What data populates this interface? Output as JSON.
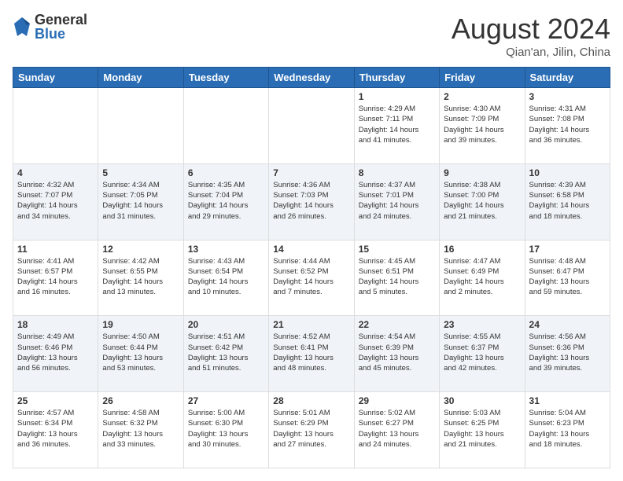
{
  "header": {
    "logo_general": "General",
    "logo_blue": "Blue",
    "month_title": "August 2024",
    "location": "Qian'an, Jilin, China"
  },
  "days_of_week": [
    "Sunday",
    "Monday",
    "Tuesday",
    "Wednesday",
    "Thursday",
    "Friday",
    "Saturday"
  ],
  "weeks": [
    [
      {
        "day": "",
        "detail": ""
      },
      {
        "day": "",
        "detail": ""
      },
      {
        "day": "",
        "detail": ""
      },
      {
        "day": "",
        "detail": ""
      },
      {
        "day": "1",
        "detail": "Sunrise: 4:29 AM\nSunset: 7:11 PM\nDaylight: 14 hours\nand 41 minutes."
      },
      {
        "day": "2",
        "detail": "Sunrise: 4:30 AM\nSunset: 7:09 PM\nDaylight: 14 hours\nand 39 minutes."
      },
      {
        "day": "3",
        "detail": "Sunrise: 4:31 AM\nSunset: 7:08 PM\nDaylight: 14 hours\nand 36 minutes."
      }
    ],
    [
      {
        "day": "4",
        "detail": "Sunrise: 4:32 AM\nSunset: 7:07 PM\nDaylight: 14 hours\nand 34 minutes."
      },
      {
        "day": "5",
        "detail": "Sunrise: 4:34 AM\nSunset: 7:05 PM\nDaylight: 14 hours\nand 31 minutes."
      },
      {
        "day": "6",
        "detail": "Sunrise: 4:35 AM\nSunset: 7:04 PM\nDaylight: 14 hours\nand 29 minutes."
      },
      {
        "day": "7",
        "detail": "Sunrise: 4:36 AM\nSunset: 7:03 PM\nDaylight: 14 hours\nand 26 minutes."
      },
      {
        "day": "8",
        "detail": "Sunrise: 4:37 AM\nSunset: 7:01 PM\nDaylight: 14 hours\nand 24 minutes."
      },
      {
        "day": "9",
        "detail": "Sunrise: 4:38 AM\nSunset: 7:00 PM\nDaylight: 14 hours\nand 21 minutes."
      },
      {
        "day": "10",
        "detail": "Sunrise: 4:39 AM\nSunset: 6:58 PM\nDaylight: 14 hours\nand 18 minutes."
      }
    ],
    [
      {
        "day": "11",
        "detail": "Sunrise: 4:41 AM\nSunset: 6:57 PM\nDaylight: 14 hours\nand 16 minutes."
      },
      {
        "day": "12",
        "detail": "Sunrise: 4:42 AM\nSunset: 6:55 PM\nDaylight: 14 hours\nand 13 minutes."
      },
      {
        "day": "13",
        "detail": "Sunrise: 4:43 AM\nSunset: 6:54 PM\nDaylight: 14 hours\nand 10 minutes."
      },
      {
        "day": "14",
        "detail": "Sunrise: 4:44 AM\nSunset: 6:52 PM\nDaylight: 14 hours\nand 7 minutes."
      },
      {
        "day": "15",
        "detail": "Sunrise: 4:45 AM\nSunset: 6:51 PM\nDaylight: 14 hours\nand 5 minutes."
      },
      {
        "day": "16",
        "detail": "Sunrise: 4:47 AM\nSunset: 6:49 PM\nDaylight: 14 hours\nand 2 minutes."
      },
      {
        "day": "17",
        "detail": "Sunrise: 4:48 AM\nSunset: 6:47 PM\nDaylight: 13 hours\nand 59 minutes."
      }
    ],
    [
      {
        "day": "18",
        "detail": "Sunrise: 4:49 AM\nSunset: 6:46 PM\nDaylight: 13 hours\nand 56 minutes."
      },
      {
        "day": "19",
        "detail": "Sunrise: 4:50 AM\nSunset: 6:44 PM\nDaylight: 13 hours\nand 53 minutes."
      },
      {
        "day": "20",
        "detail": "Sunrise: 4:51 AM\nSunset: 6:42 PM\nDaylight: 13 hours\nand 51 minutes."
      },
      {
        "day": "21",
        "detail": "Sunrise: 4:52 AM\nSunset: 6:41 PM\nDaylight: 13 hours\nand 48 minutes."
      },
      {
        "day": "22",
        "detail": "Sunrise: 4:54 AM\nSunset: 6:39 PM\nDaylight: 13 hours\nand 45 minutes."
      },
      {
        "day": "23",
        "detail": "Sunrise: 4:55 AM\nSunset: 6:37 PM\nDaylight: 13 hours\nand 42 minutes."
      },
      {
        "day": "24",
        "detail": "Sunrise: 4:56 AM\nSunset: 6:36 PM\nDaylight: 13 hours\nand 39 minutes."
      }
    ],
    [
      {
        "day": "25",
        "detail": "Sunrise: 4:57 AM\nSunset: 6:34 PM\nDaylight: 13 hours\nand 36 minutes."
      },
      {
        "day": "26",
        "detail": "Sunrise: 4:58 AM\nSunset: 6:32 PM\nDaylight: 13 hours\nand 33 minutes."
      },
      {
        "day": "27",
        "detail": "Sunrise: 5:00 AM\nSunset: 6:30 PM\nDaylight: 13 hours\nand 30 minutes."
      },
      {
        "day": "28",
        "detail": "Sunrise: 5:01 AM\nSunset: 6:29 PM\nDaylight: 13 hours\nand 27 minutes."
      },
      {
        "day": "29",
        "detail": "Sunrise: 5:02 AM\nSunset: 6:27 PM\nDaylight: 13 hours\nand 24 minutes."
      },
      {
        "day": "30",
        "detail": "Sunrise: 5:03 AM\nSunset: 6:25 PM\nDaylight: 13 hours\nand 21 minutes."
      },
      {
        "day": "31",
        "detail": "Sunrise: 5:04 AM\nSunset: 6:23 PM\nDaylight: 13 hours\nand 18 minutes."
      }
    ]
  ]
}
